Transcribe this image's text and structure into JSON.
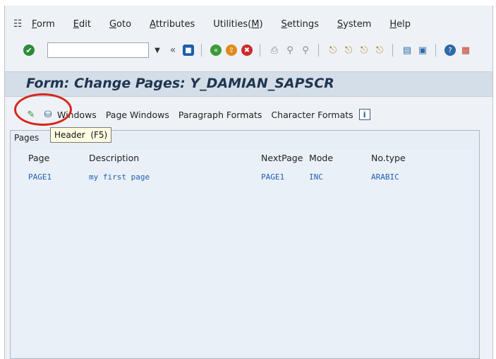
{
  "menu": {
    "system_icon": "menu-system-icon",
    "items": [
      {
        "label": "Form",
        "u": "F",
        "rest": "orm"
      },
      {
        "label": "Edit",
        "u": "E",
        "rest": "dit"
      },
      {
        "label": "Goto",
        "u": "G",
        "rest": "oto"
      },
      {
        "label": "Attributes",
        "u": "A",
        "rest": "ttributes"
      },
      {
        "label": "Utilities(M)",
        "pre": "Utilities(",
        "u": "M",
        "rest": ")"
      },
      {
        "label": "Settings",
        "u": "S",
        "rest": "ettings"
      },
      {
        "label": "System",
        "u": "S",
        "rest": "ystem"
      },
      {
        "label": "Help",
        "u": "H",
        "rest": "elp"
      }
    ]
  },
  "toolbar": {
    "command_field_value": "",
    "colors": {
      "ok": "#2e8b3a",
      "save": "#1f5fa8",
      "back": "#3b9a3b",
      "exit": "#e08a1c",
      "cancel": "#cc2b2b"
    }
  },
  "title": "Form: Change Pages: Y_DAMIAN_SAPSCR",
  "app_toolbar": {
    "buttons": [
      "Windows",
      "Page Windows",
      "Paragraph Formats",
      "Character Formats"
    ]
  },
  "tab_label": "Pages",
  "tooltip": "Header  (F5)",
  "table": {
    "headers": [
      "Page",
      "Description",
      "NextPage",
      "Mode",
      "No.type"
    ],
    "rows": [
      [
        "PAGE1",
        "my first page",
        "PAGE1",
        "INC",
        "ARABIC"
      ]
    ]
  },
  "highlight_color": "#d8261c"
}
